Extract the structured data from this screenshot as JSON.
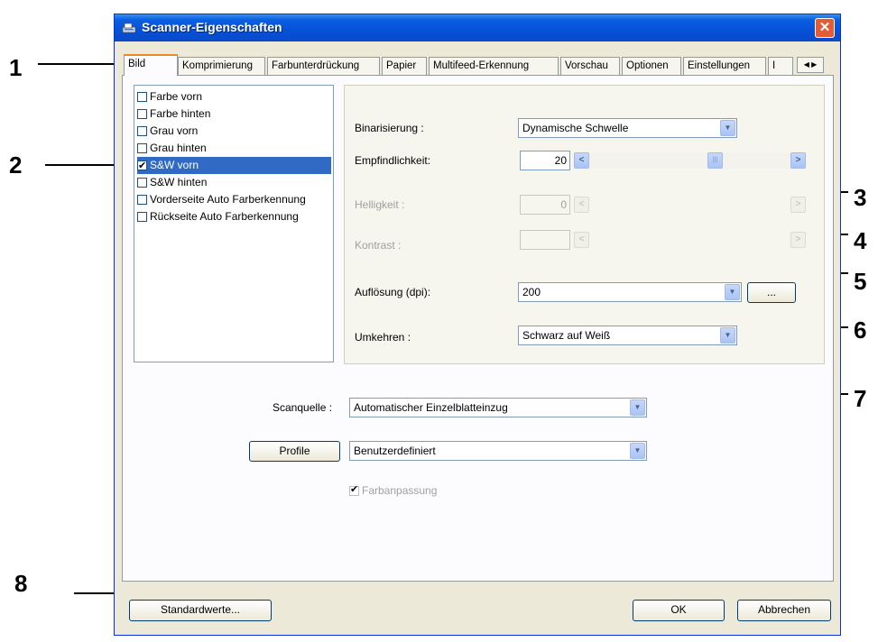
{
  "window": {
    "title": "Scanner-Eigenschaften",
    "close_glyph": "✕"
  },
  "tabs": [
    {
      "label": "Bild",
      "active": true
    },
    {
      "label": "Komprimierung"
    },
    {
      "label": "Farbunterdrückung"
    },
    {
      "label": "Papier"
    },
    {
      "label": "Multifeed-Erkennung"
    },
    {
      "label": "Vorschau"
    },
    {
      "label": "Optionen"
    },
    {
      "label": "Einstellungen"
    },
    {
      "label": "I"
    }
  ],
  "tab_scroll_glyph": "◀ ▶",
  "image_types": [
    {
      "label": "Farbe vorn",
      "checked": false
    },
    {
      "label": "Farbe hinten",
      "checked": false
    },
    {
      "label": "Grau vorn",
      "checked": false
    },
    {
      "label": "Grau hinten",
      "checked": false
    },
    {
      "label": "S&W vorn",
      "checked": true,
      "selected": true
    },
    {
      "label": "S&W hinten",
      "checked": false
    },
    {
      "label": "Vorderseite Auto Farberkennung",
      "checked": false
    },
    {
      "label": "Rückseite Auto Farberkennung",
      "checked": false
    }
  ],
  "settings": {
    "binarization": {
      "label": "Binarisierung :",
      "value": "Dynamische Schwelle"
    },
    "sensitivity": {
      "label": "Empfindlichkeit:",
      "value": "20"
    },
    "brightness": {
      "label": "Helligkeit :",
      "value": "0"
    },
    "contrast": {
      "label": "Kontrast :",
      "value": ""
    },
    "resolution": {
      "label": "Auflösung (dpi):",
      "value": "200",
      "more_label": "..."
    },
    "invert": {
      "label": "Umkehren :",
      "value": "Schwarz auf Weiß"
    }
  },
  "scan_source": {
    "label": "Scanquelle :",
    "value": "Automatischer Einzelblatteinzug"
  },
  "profile": {
    "button_label": "Profile",
    "value": "Benutzerdefiniert"
  },
  "color_matching": {
    "label": "Farbanpassung",
    "checked": true
  },
  "footer": {
    "defaults_label": "Standardwerte...",
    "ok_label": "OK",
    "cancel_label": "Abbrechen"
  },
  "callouts": [
    "1",
    "2",
    "3",
    "4",
    "5",
    "6",
    "7",
    "8"
  ],
  "glyphs": {
    "combo_arrow": "▼",
    "left_arrow": "<",
    "right_arrow": ">",
    "thumb": "|||"
  }
}
